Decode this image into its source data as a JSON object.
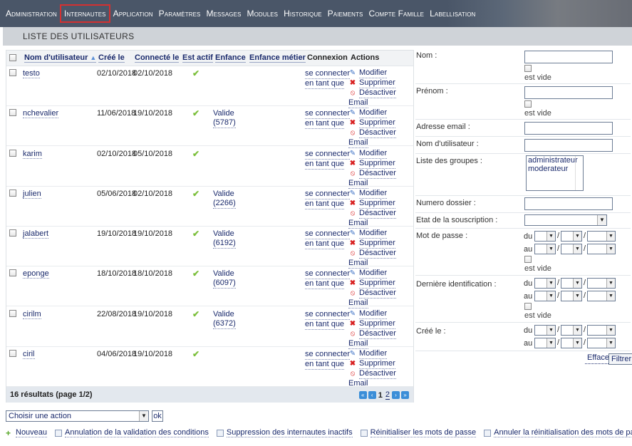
{
  "nav": [
    "Administration",
    "Internautes",
    "Application",
    "Paramètres",
    "Messages",
    "Modules",
    "Historique",
    "Paiements",
    "Compte Famille",
    "Labellisation"
  ],
  "page_title": "LISTE DES UTILISATEURS",
  "table": {
    "headers": {
      "username": "Nom d'utilisateur",
      "created": "Créé le",
      "connected": "Connecté le",
      "active": "Est actif",
      "enfance": "Enfance",
      "enfance_metier": "Enfance métier",
      "connexion": "Connexion",
      "actions": "Actions"
    },
    "rows": [
      {
        "user": "testo",
        "created": "02/10/2018",
        "connected": "02/10/2018",
        "enf1": "",
        "enf2": ""
      },
      {
        "user": "nchevalier",
        "created": "11/06/2018",
        "connected": "19/10/2018",
        "enf1": "Valide",
        "enf2": "(5787)"
      },
      {
        "user": "karim",
        "created": "02/10/2018",
        "connected": "05/10/2018",
        "enf1": "",
        "enf2": ""
      },
      {
        "user": "julien",
        "created": "05/06/2018",
        "connected": "02/10/2018",
        "enf1": "Valide",
        "enf2": "(2266)"
      },
      {
        "user": "jalabert",
        "created": "19/10/2018",
        "connected": "19/10/2018",
        "enf1": "Valide",
        "enf2": "(6192)"
      },
      {
        "user": "eponge",
        "created": "18/10/2018",
        "connected": "18/10/2018",
        "enf1": "Valide",
        "enf2": "(6097)"
      },
      {
        "user": "cirilm",
        "created": "22/08/2018",
        "connected": "19/10/2018",
        "enf1": "Valide",
        "enf2": "(6372)"
      },
      {
        "user": "ciril",
        "created": "04/06/2018",
        "connected": "19/10/2018",
        "enf1": "",
        "enf2": ""
      }
    ],
    "connect_line1": "se connecter",
    "connect_line2": "en tant que",
    "act_modify": "Modifier",
    "act_delete": "Supprimer",
    "act_deactivate": "Désactiver",
    "act_email": "Email",
    "results": "16 résultats (page 1/2)",
    "pages": [
      "1",
      "2"
    ]
  },
  "filters": {
    "nom": "Nom :",
    "prenom": "Prénom :",
    "email": "Adresse email :",
    "username": "Nom d'utilisateur :",
    "groups": "Liste des groupes :",
    "group_options": [
      "administrateur",
      "moderateur"
    ],
    "dossier": "Numero dossier :",
    "souscription": "Etat de la souscription :",
    "password": "Mot de passe :",
    "last_login": "Dernière identification :",
    "created": "Créé le :",
    "est_vide": "est vide",
    "du": "du",
    "au": "au",
    "clear": "Effacer",
    "filter": "Filtrer"
  },
  "bottom": {
    "action_placeholder": "Choisir une action",
    "ok": "ok",
    "links": [
      "Nouveau",
      "Annulation de la validation des conditions",
      "Suppression des internautes inactifs",
      "Réinitialiser les mots de passe",
      "Annuler la réinitialisation des mots de passe"
    ]
  }
}
